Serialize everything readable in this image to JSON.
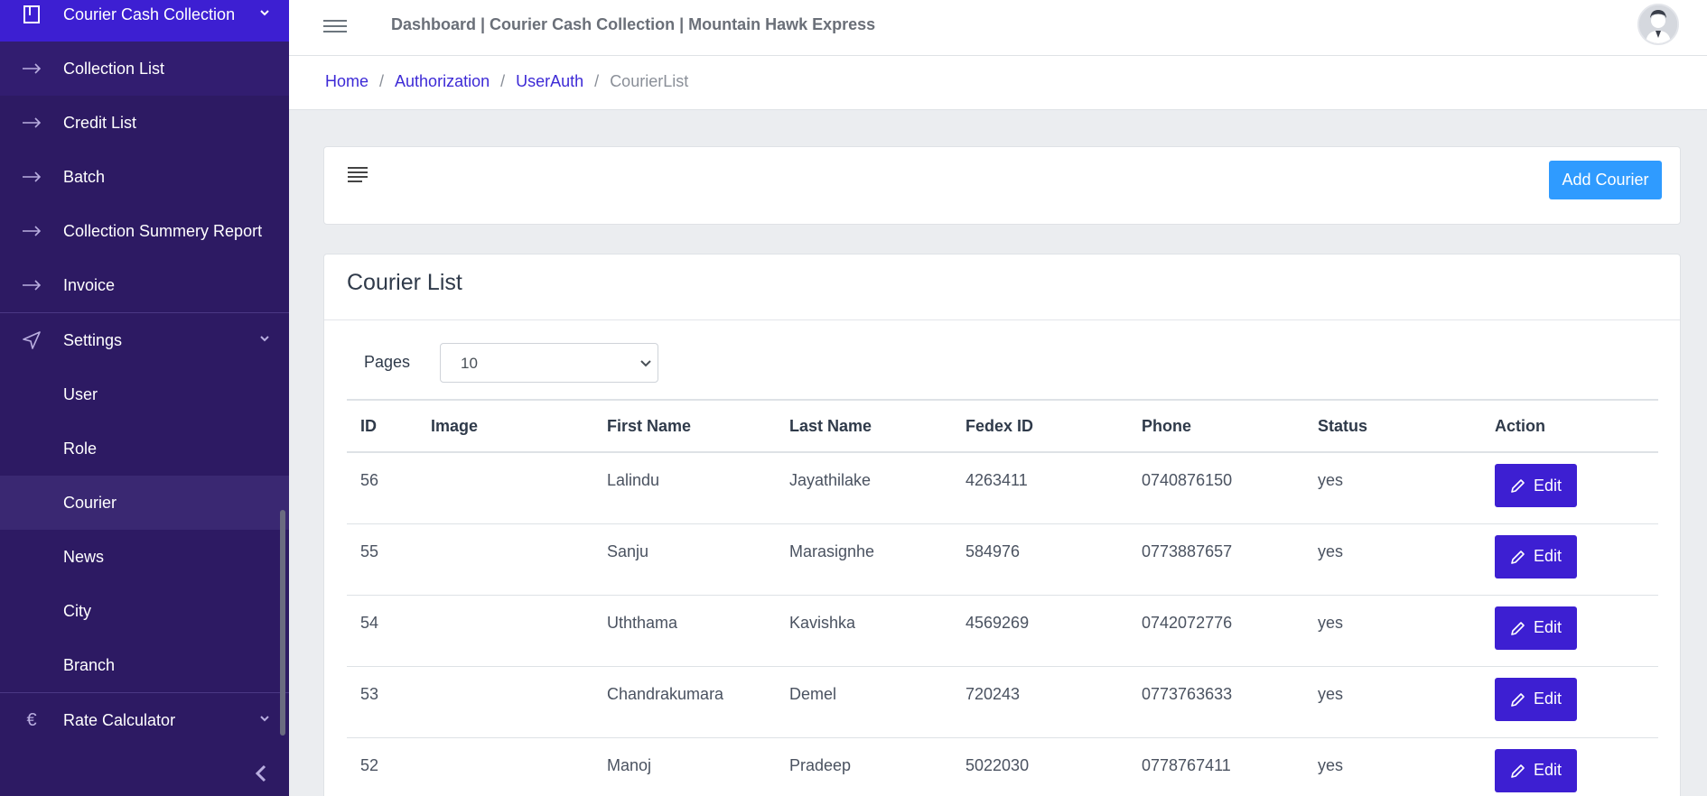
{
  "sidebar": {
    "items": [
      {
        "label": "Courier Cash Collection",
        "icon": "book-icon",
        "expanded": true
      },
      {
        "label": "Collection List",
        "icon": "arrow-right-icon"
      },
      {
        "label": "Credit List",
        "icon": "arrow-right-icon"
      },
      {
        "label": "Batch",
        "icon": "arrow-right-icon"
      },
      {
        "label": "Collection Summery Report",
        "icon": "arrow-right-icon"
      },
      {
        "label": "Invoice",
        "icon": "arrow-right-icon"
      },
      {
        "label": "Settings",
        "icon": "send-icon",
        "expanded": true
      },
      {
        "label": "User"
      },
      {
        "label": "Role"
      },
      {
        "label": "Courier",
        "selected": true
      },
      {
        "label": "News"
      },
      {
        "label": "City"
      },
      {
        "label": "Branch"
      },
      {
        "label": "Rate Calculator",
        "icon": "euro-icon",
        "expanded": false
      }
    ]
  },
  "header": {
    "title": "Dashboard | Courier Cash Collection | Mountain Hawk Express"
  },
  "breadcrumb": {
    "items": [
      "Home",
      "Authorization",
      "UserAuth"
    ],
    "current": "CourierList"
  },
  "toolbar": {
    "add_label": "Add Courier"
  },
  "list": {
    "title": "Courier List",
    "pages_label": "Pages",
    "pages_value": "10",
    "columns": [
      "ID",
      "Image",
      "First Name",
      "Last Name",
      "Fedex ID",
      "Phone",
      "Status",
      "Action"
    ],
    "edit_label": "Edit",
    "rows": [
      {
        "id": "56",
        "first": "Lalindu",
        "last": "Jayathilake",
        "fedex": "4263411",
        "phone": "0740876150",
        "status": "yes"
      },
      {
        "id": "55",
        "first": "Sanju",
        "last": "Marasignhe",
        "fedex": "584976",
        "phone": "0773887657",
        "status": "yes"
      },
      {
        "id": "54",
        "first": "Uththama",
        "last": "Kavishka",
        "fedex": "4569269",
        "phone": "0742072776",
        "status": "yes"
      },
      {
        "id": "53",
        "first": "Chandrakumara",
        "last": "Demel",
        "fedex": "720243",
        "phone": "0773763633",
        "status": "yes"
      },
      {
        "id": "52",
        "first": "Manoj",
        "last": "Pradeep",
        "fedex": "5022030",
        "phone": "0778767411",
        "status": "yes"
      }
    ]
  },
  "colors": {
    "sidebar_bg": "#2d1a63",
    "active_item": "#3d1fd2",
    "primary_button": "#2f9bff",
    "edit_button": "#3d1fd2",
    "link": "#3d2ad6"
  }
}
